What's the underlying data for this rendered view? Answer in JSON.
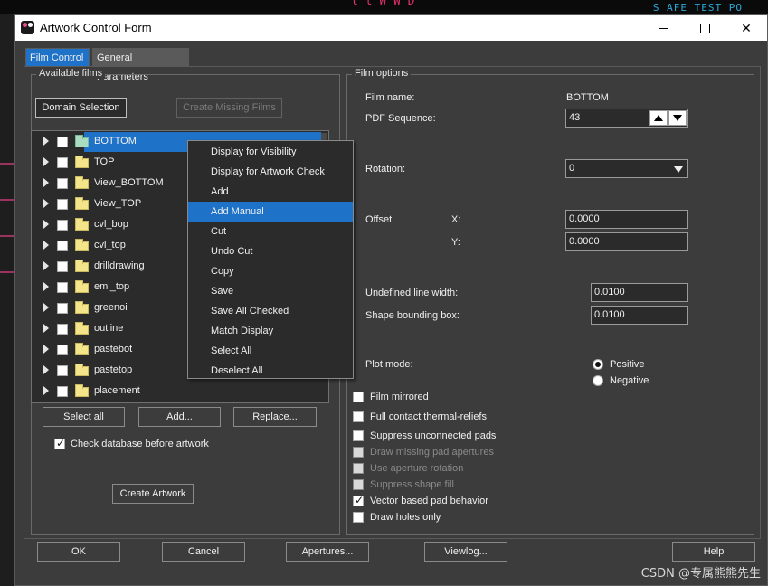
{
  "background": {
    "pcb_text_top": "l l W W D",
    "pcb_text_right": "S AFE TEST PO"
  },
  "window": {
    "title": "Artwork Control Form"
  },
  "tabs": [
    {
      "label": "Film Control",
      "active": true
    },
    {
      "label": "General Parameters",
      "active": false
    }
  ],
  "available_films": {
    "group_label": "Available films",
    "domain_selection_label": "Domain Selection",
    "create_missing_films_label": "Create Missing Films",
    "films": [
      {
        "name": "BOTTOM",
        "selected": true,
        "checked": false
      },
      {
        "name": "TOP",
        "selected": false,
        "checked": false
      },
      {
        "name": "View_BOTTOM",
        "selected": false,
        "checked": false
      },
      {
        "name": "View_TOP",
        "selected": false,
        "checked": false
      },
      {
        "name": "cvl_bop",
        "selected": false,
        "checked": false
      },
      {
        "name": "cvl_top",
        "selected": false,
        "checked": false
      },
      {
        "name": "drilldrawing",
        "selected": false,
        "checked": false
      },
      {
        "name": "emi_top",
        "selected": false,
        "checked": false
      },
      {
        "name": "greenoi",
        "selected": false,
        "checked": false
      },
      {
        "name": "outline",
        "selected": false,
        "checked": false
      },
      {
        "name": "pastebot",
        "selected": false,
        "checked": false
      },
      {
        "name": "pastetop",
        "selected": false,
        "checked": false
      },
      {
        "name": "placement",
        "selected": false,
        "checked": false
      }
    ],
    "select_all_label": "Select all",
    "add_label": "Add...",
    "replace_label": "Replace...",
    "check_database_label": "Check database before artwork",
    "check_database_checked": true,
    "create_artwork_label": "Create Artwork"
  },
  "context_menu": {
    "items": [
      {
        "label": "Display for Visibility",
        "hover": false
      },
      {
        "label": "Display for Artwork Check",
        "hover": false
      },
      {
        "label": "Add",
        "hover": false
      },
      {
        "label": "Add Manual",
        "hover": true
      },
      {
        "label": "Cut",
        "hover": false
      },
      {
        "label": "Undo Cut",
        "hover": false
      },
      {
        "label": "Copy",
        "hover": false
      },
      {
        "label": "Save",
        "hover": false
      },
      {
        "label": "Save All Checked",
        "hover": false
      },
      {
        "label": "Match Display",
        "hover": false
      },
      {
        "label": "Select All",
        "hover": false
      },
      {
        "label": "Deselect All",
        "hover": false
      }
    ]
  },
  "film_options": {
    "group_label": "Film options",
    "film_name_label": "Film name:",
    "film_name_value": "BOTTOM",
    "pdf_sequence_label": "PDF Sequence:",
    "pdf_sequence_value": "43",
    "rotation_label": "Rotation:",
    "rotation_value": "0",
    "offset_label": "Offset",
    "offset_x_label": "X:",
    "offset_x_value": "0.0000",
    "offset_y_label": "Y:",
    "offset_y_value": "0.0000",
    "undefined_line_width_label": "Undefined line width:",
    "undefined_line_width_value": "0.0100",
    "shape_bounding_box_label": "Shape bounding box:",
    "shape_bounding_box_value": "0.0100",
    "plot_mode_label": "Plot mode:",
    "plot_mode_positive_label": "Positive",
    "plot_mode_negative_label": "Negative",
    "plot_mode_selected": "Positive",
    "options": [
      {
        "label": "Film mirrored",
        "checked": false,
        "disabled": false
      },
      {
        "label": "Full contact thermal-reliefs",
        "checked": false,
        "disabled": false
      },
      {
        "label": "Suppress unconnected pads",
        "checked": false,
        "disabled": false
      },
      {
        "label": "Draw missing pad apertures",
        "checked": false,
        "disabled": true
      },
      {
        "label": "Use aperture rotation",
        "checked": false,
        "disabled": true
      },
      {
        "label": "Suppress shape fill",
        "checked": false,
        "disabled": true
      },
      {
        "label": "Vector based pad behavior",
        "checked": true,
        "disabled": false
      },
      {
        "label": "Draw holes only",
        "checked": false,
        "disabled": false
      }
    ]
  },
  "footer": {
    "ok_label": "OK",
    "cancel_label": "Cancel",
    "apertures_label": "Apertures...",
    "viewlog_label": "Viewlog...",
    "help_label": "Help"
  },
  "watermark": "CSDN @专属熊熊先生"
}
